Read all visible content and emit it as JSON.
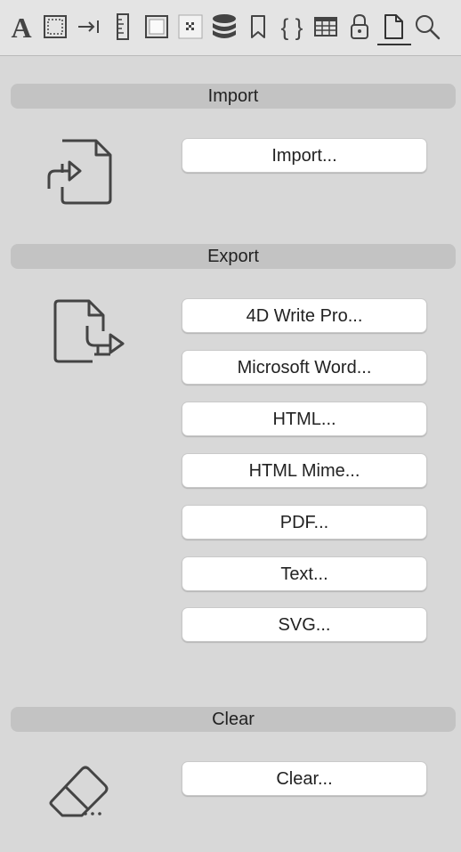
{
  "toolbar": {
    "icons": [
      {
        "name": "font-icon",
        "glyph": "A"
      },
      {
        "name": "frame-icon"
      },
      {
        "name": "indent-icon"
      },
      {
        "name": "ruler-icon"
      },
      {
        "name": "background-icon"
      },
      {
        "name": "pattern-icon"
      },
      {
        "name": "database-icon"
      },
      {
        "name": "bookmark-icon"
      },
      {
        "name": "braces-icon",
        "glyph": "{ }"
      },
      {
        "name": "table-icon"
      },
      {
        "name": "lock-icon"
      },
      {
        "name": "document-icon",
        "selected": true
      },
      {
        "name": "search-icon"
      }
    ]
  },
  "import": {
    "header": "Import",
    "buttons": [
      "Import..."
    ]
  },
  "export": {
    "header": "Export",
    "buttons": [
      "4D Write Pro...",
      "Microsoft Word...",
      "HTML...",
      "HTML Mime...",
      "PDF...",
      "Text...",
      "SVG..."
    ]
  },
  "clear": {
    "header": "Clear",
    "buttons": [
      "Clear..."
    ]
  },
  "colors": {
    "panel_bg": "#d8d8d8",
    "header_bg": "#c3c3c3",
    "button_bg": "#ffffff",
    "icon_color": "#444444"
  }
}
